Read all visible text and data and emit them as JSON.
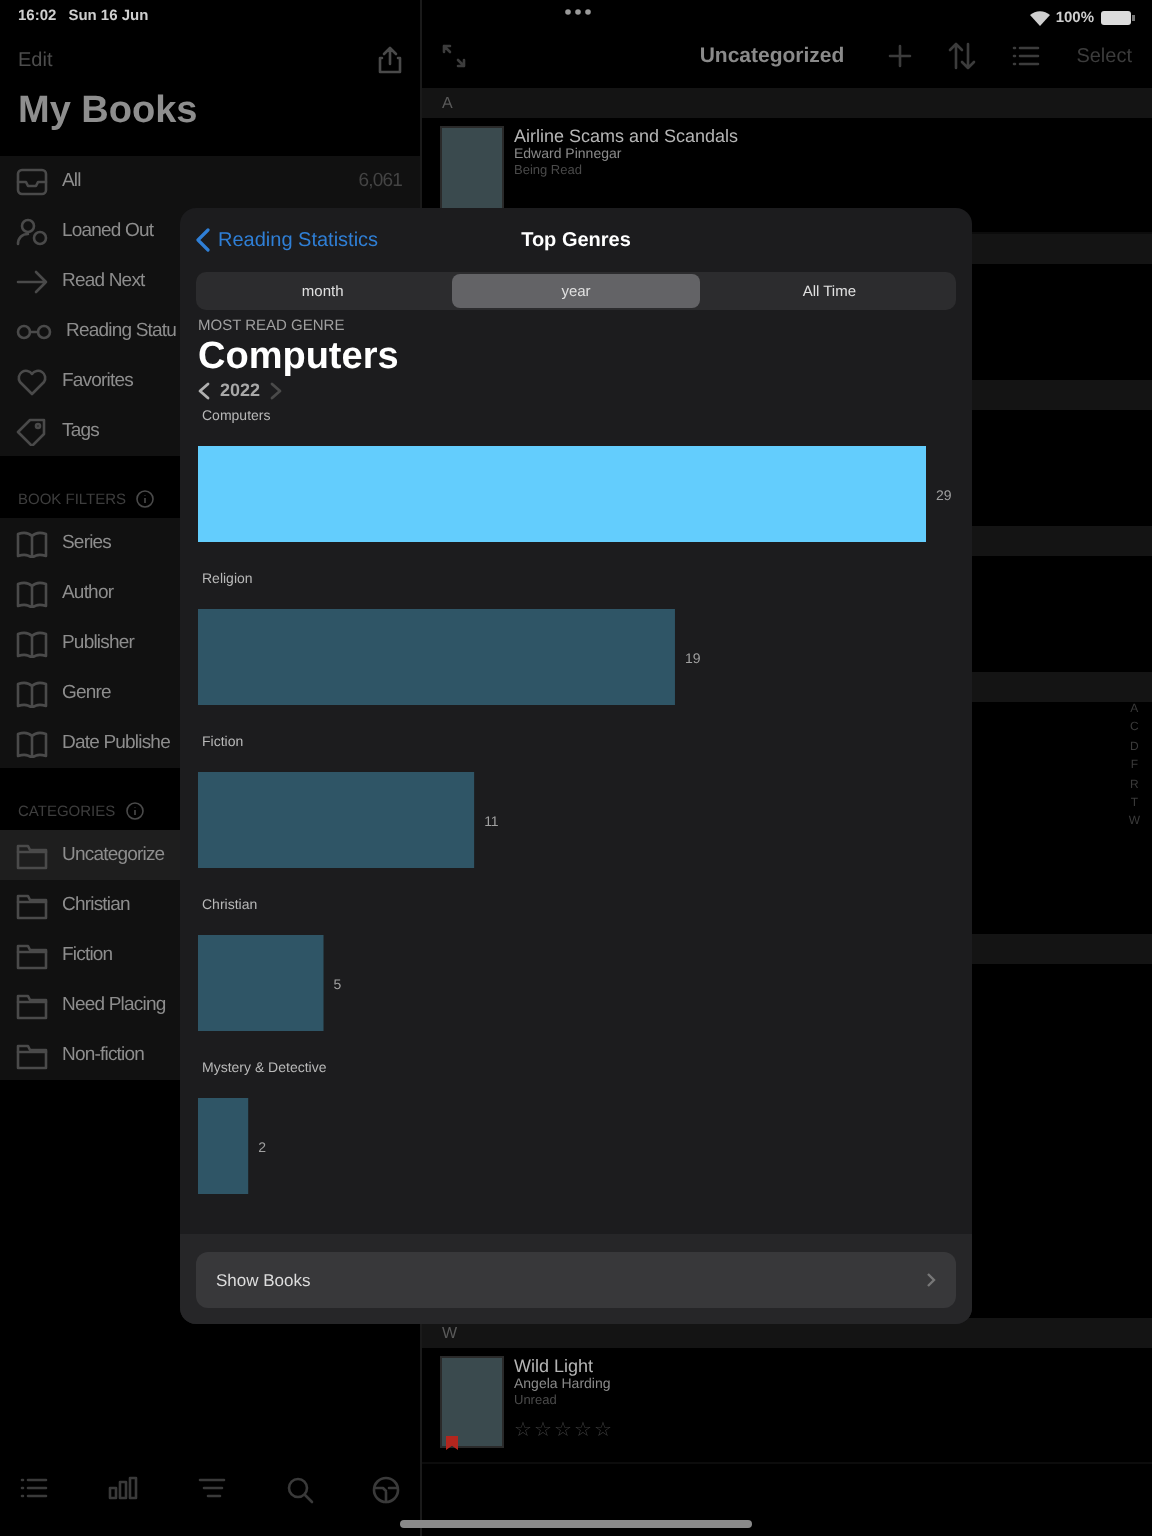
{
  "status_bar": {
    "time": "16:02",
    "date": "Sun 16 Jun",
    "battery": "100%"
  },
  "sidebar": {
    "edit": "Edit",
    "title": "My Books",
    "library_items": [
      {
        "label": "All",
        "count": "6,061"
      },
      {
        "label": "Loaned Out"
      },
      {
        "label": "Read Next"
      },
      {
        "label": "Reading Statu"
      },
      {
        "label": "Favorites"
      },
      {
        "label": "Tags"
      }
    ],
    "filters_heading": "BOOK FILTERS",
    "filters": [
      {
        "label": "Series"
      },
      {
        "label": "Author"
      },
      {
        "label": "Publisher"
      },
      {
        "label": "Genre"
      },
      {
        "label": "Date Publishe"
      }
    ],
    "categories_heading": "CATEGORIES",
    "categories": [
      {
        "label": "Uncategorize",
        "selected": true
      },
      {
        "label": "Christian",
        "selected": false
      },
      {
        "label": "Fiction",
        "selected": false
      },
      {
        "label": "Need Placing",
        "selected": false
      },
      {
        "label": "Non-fiction",
        "selected": false
      }
    ]
  },
  "book_list": {
    "title": "Uncategorized",
    "select": "Select",
    "index_letters": [
      "A",
      "C",
      "D",
      "F",
      "R",
      "T",
      "W"
    ],
    "sections": [
      {
        "letter": "A",
        "books": [
          {
            "title": "Airline Scams and Scandals",
            "author": "Edward Pinnegar",
            "status": "Being Read"
          }
        ]
      },
      {
        "letter": "W",
        "books": [
          {
            "title": "Wild Light",
            "author": "Angela Harding",
            "status": "Unread",
            "flagged": true,
            "stars": 0
          }
        ]
      }
    ]
  },
  "stats": {
    "back": "Reading Statistics",
    "title": "Top Genres",
    "periods": [
      {
        "label": "month",
        "selected": false
      },
      {
        "label": "year",
        "selected": true
      },
      {
        "label": "All Time",
        "selected": false
      }
    ],
    "caption": "MOST READ GENRE",
    "top_genre": "Computers",
    "year_nav": {
      "label": "2022",
      "previous_disabled": false,
      "next_disabled": true
    },
    "chart_data": {
      "type": "bar",
      "orientation": "horizontal",
      "categories": [
        "Computers",
        "Religion",
        "Fiction",
        "Christian",
        "Mystery & Detective"
      ],
      "values": [
        29,
        19,
        11,
        5,
        2
      ],
      "data_labels": true
    },
    "show_books": "Show Books"
  }
}
